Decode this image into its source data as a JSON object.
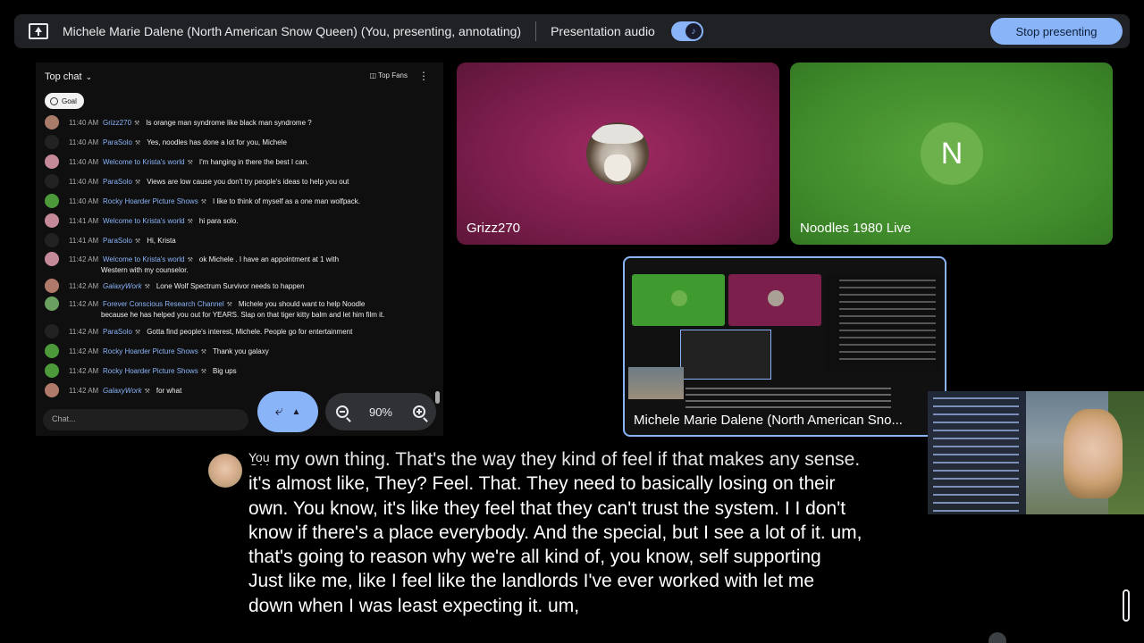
{
  "topbar": {
    "presenter": "Michele Marie Dalene (North American Snow Queen) (You, presenting, annotating)",
    "audio_label": "Presentation audio",
    "stop_label": "Stop presenting"
  },
  "chat": {
    "mode_label": "Top chat",
    "top_fans_label": "Top Fans",
    "goal_label": "Goal",
    "input_placeholder": "Chat...",
    "messages": [
      {
        "time": "11:40 AM",
        "author": "Grizz270",
        "text": "Is orange man syndrome like black man syndrome ?",
        "avatar_color": "#a97c6a"
      },
      {
        "time": "11:40 AM",
        "author": "ParaSolo",
        "text": "Yes, noodles has done a lot for you, Michele",
        "avatar_color": "#222222"
      },
      {
        "time": "11:40 AM",
        "author": "Welcome to Krista's world",
        "text": "I'm hanging in there the best I can.",
        "avatar_color": "#c48a9a"
      },
      {
        "time": "11:40 AM",
        "author": "ParaSolo",
        "text": "Views are low cause you don't try people's ideas to help you out",
        "avatar_color": "#222222"
      },
      {
        "time": "11:40 AM",
        "author": "Rocky Hoarder Picture Shows",
        "text": "I like to think of myself as a one man wolfpack.",
        "avatar_color": "#4c9a3a"
      },
      {
        "time": "11:41 AM",
        "author": "Welcome to Krista's world",
        "text": "hi para solo.",
        "avatar_color": "#c48a9a"
      },
      {
        "time": "11:41 AM",
        "author": "ParaSolo",
        "text": "Hi, Krista",
        "avatar_color": "#222222"
      },
      {
        "time": "11:42 AM",
        "author": "Welcome to Krista's world",
        "text": "ok Michele . I have an appointment at 1 with",
        "text2": "Western with my counselor.",
        "avatar_color": "#c48a9a"
      },
      {
        "time": "11:42 AM",
        "author": "GalaxyWork",
        "text": "Lone Wolf Spectrum Survivor needs to happen",
        "avatar_color": "#b07a6a"
      },
      {
        "time": "11:42 AM",
        "author": "Forever Conscious Research Channel",
        "text": "Michele you should want to help Noodle",
        "text2": "because he has helped you out for YEARS. Slap on that tiger kitty balm and let him film it.",
        "avatar_color": "#6aa060"
      },
      {
        "time": "11:42 AM",
        "author": "ParaSolo",
        "text": "Gotta find people's interest, Michele. People go for entertainment",
        "avatar_color": "#222222"
      },
      {
        "time": "11:42 AM",
        "author": "Rocky Hoarder Picture Shows",
        "text": "Thank you galaxy",
        "avatar_color": "#4c9a3a"
      },
      {
        "time": "11:42 AM",
        "author": "Rocky Hoarder Picture Shows",
        "text": "Big ups",
        "avatar_color": "#4c9a3a"
      },
      {
        "time": "11:42 AM",
        "author": "GalaxyWork",
        "text": "for what",
        "avatar_color": "#b07a6a"
      }
    ]
  },
  "zoom": {
    "level": "90%"
  },
  "tiles": {
    "grizz": "Grizz270",
    "noodles": "Noodles 1980 Live",
    "noodles_initial": "N",
    "self": "Michele Marie Dalene (North American Sno..."
  },
  "caption": {
    "speaker": "You",
    "lines": [
      "on my own thing. That's the way they kind of feel if that makes any sense.",
      "it's almost like, They? Feel. That. They need to basically losing on their",
      "own. You know, it's like they feel that they can't trust the system. I I don't",
      "know if there's a place everybody. And the special, but I see a lot of it. um,",
      "that's going to reason why we're all kind of, you know, self supporting",
      "Just like me, like I feel like the landlords I've ever worked with let me",
      "down when I was least expecting it. um,"
    ]
  },
  "colors": {
    "accent": "#8ab4f8",
    "bar_bg": "#202124"
  }
}
